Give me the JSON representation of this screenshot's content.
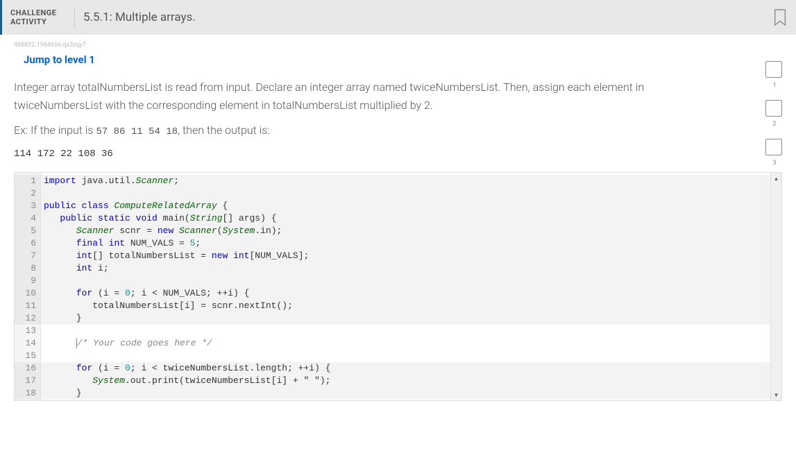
{
  "header": {
    "challenge_label": "CHALLENGE\nACTIVITY",
    "title": "5.5.1: Multiple arrays."
  },
  "tiny_id": "488822.1984656.qx3zqy7",
  "jump_link": "Jump to level 1",
  "prompt": "Integer array totalNumbersList is read from input. Declare an integer array named twiceNumbersList. Then, assign each element in twiceNumbersList with the corresponding element in totalNumbersList multiplied by 2.",
  "example_prefix": "Ex: If the input is ",
  "example_input": "57 86 11 54 18",
  "example_suffix": ", then the output is:",
  "example_output": "114 172 22 108 36",
  "code": {
    "lines": [
      {
        "n": 1,
        "ro": true,
        "html": "<span class='kw'>import</span> java.util.<span class='cls'>Scanner</span>;"
      },
      {
        "n": 2,
        "ro": true,
        "html": ""
      },
      {
        "n": 3,
        "ro": true,
        "html": "<span class='kw'>public</span> <span class='kw'>class</span> <span class='cls'>ComputeRelatedArray</span> {"
      },
      {
        "n": 4,
        "ro": true,
        "html": "   <span class='kw'>public</span> <span class='kw'>static</span> <span class='kw'>void</span> main(<span class='cls'>String</span>[] args) {"
      },
      {
        "n": 5,
        "ro": true,
        "html": "      <span class='cls'>Scanner</span> scnr = <span class='kw'>new</span> <span class='cls'>Scanner</span>(<span class='cls'>System</span>.in);"
      },
      {
        "n": 6,
        "ro": true,
        "html": "      <span class='kw'>final</span> <span class='kw'>int</span> NUM_VALS = <span class='num'>5</span>;"
      },
      {
        "n": 7,
        "ro": true,
        "html": "      <span class='kw'>int</span>[] totalNumbersList = <span class='kw'>new</span> <span class='kw'>int</span>[NUM_VALS];"
      },
      {
        "n": 8,
        "ro": true,
        "html": "      <span class='kw'>int</span> i;"
      },
      {
        "n": 9,
        "ro": true,
        "html": ""
      },
      {
        "n": 10,
        "ro": true,
        "html": "      <span class='kw'>for</span> (i = <span class='num'>0</span>; i &lt; NUM_VALS; ++i) {"
      },
      {
        "n": 11,
        "ro": true,
        "html": "         totalNumbersList[i] = scnr.nextInt();"
      },
      {
        "n": 12,
        "ro": true,
        "html": "      }"
      },
      {
        "n": 13,
        "ro": false,
        "html": ""
      },
      {
        "n": 14,
        "ro": false,
        "html": "      <span style='border-left:1px solid #888;'></span><span class='cmt'>/* Your code goes here */</span>"
      },
      {
        "n": 15,
        "ro": false,
        "html": ""
      },
      {
        "n": 16,
        "ro": true,
        "html": "      <span class='kw'>for</span> (i = <span class='num'>0</span>; i &lt; twiceNumbersList.length; ++i) {"
      },
      {
        "n": 17,
        "ro": true,
        "html": "         <span class='cls'>System</span>.out.print(twiceNumbersList[i] + \" \");"
      },
      {
        "n": 18,
        "ro": true,
        "html": "      }"
      }
    ]
  },
  "steps": [
    1,
    2,
    3
  ]
}
